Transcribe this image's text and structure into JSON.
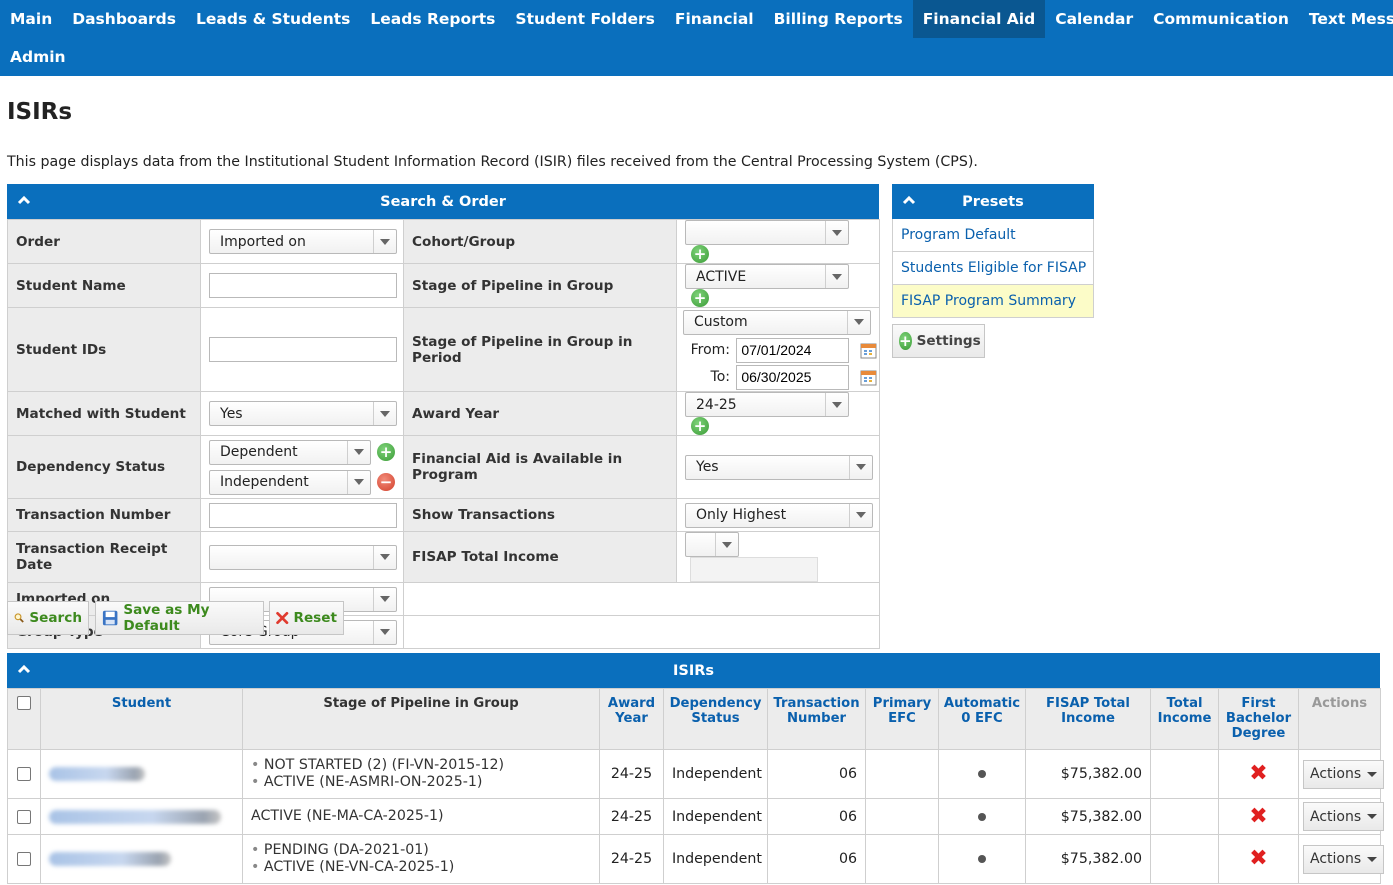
{
  "nav": {
    "items": [
      "Main",
      "Dashboards",
      "Leads & Students",
      "Leads Reports",
      "Student Folders",
      "Financial",
      "Billing Reports",
      "Financial Aid",
      "Calendar",
      "Communication",
      "Text Messages"
    ],
    "row2": [
      "Admin"
    ],
    "active": "Financial Aid"
  },
  "page": {
    "title": "ISIRs",
    "description": "This page displays data from the Institutional Student Information Record (ISIR) files received from the Central Processing System (CPS)."
  },
  "search": {
    "heading": "Search & Order",
    "order_label": "Order",
    "order_value": "Imported on",
    "student_name_label": "Student Name",
    "student_name_value": "",
    "student_ids_label": "Student IDs",
    "student_ids_value": "",
    "matched_label": "Matched with Student",
    "matched_value": "Yes",
    "dependency_label": "Dependency Status",
    "dependency_values": [
      "Dependent",
      "Independent"
    ],
    "transaction_number_label": "Transaction Number",
    "transaction_number_value": "",
    "receipt_date_label": "Transaction Receipt Date",
    "receipt_date_value": "",
    "imported_label": "Imported on",
    "imported_value": "",
    "group_type_label": "Group Type",
    "group_type_value": "Core Group",
    "cohort_label": "Cohort/Group",
    "cohort_value": "",
    "stage_label": "Stage of Pipeline in Group",
    "stage_value": "ACTIVE",
    "stage_period_label": "Stage of Pipeline in Group in Period",
    "stage_period_value": "Custom",
    "from_label": "From:",
    "from_value": "07/01/2024",
    "to_label": "To:",
    "to_value": "06/30/2025",
    "award_year_label": "Award Year",
    "award_year_value": "24-25",
    "fa_available_label": "Financial Aid is Available in Program",
    "fa_available_value": "Yes",
    "show_transactions_label": "Show Transactions",
    "show_transactions_value": "Only Highest",
    "fisap_label": "FISAP Total Income",
    "fisap_value": ""
  },
  "buttons": {
    "search": "Search",
    "save_default": "Save as My Default",
    "reset": "Reset",
    "settings": "Settings"
  },
  "presets": {
    "heading": "Presets",
    "items": [
      "Program Default",
      "Students Eligible for FISAP",
      "FISAP Program Summary"
    ]
  },
  "isirs": {
    "heading": "ISIRs",
    "columns": {
      "student": "Student",
      "stage": "Stage of Pipeline in Group",
      "award_year": "Award Year",
      "dependency": "Dependency Status",
      "transaction": "Transaction Number",
      "primary_efc": "Primary EFC",
      "auto_efc": "Automatic 0 EFC",
      "fisap": "FISAP Total Income",
      "total_income": "Total Income",
      "first_bachelor": "First Bachelor Degree",
      "actions": "Actions"
    },
    "rows": [
      {
        "stages": [
          "NOT STARTED (2) (FI-VN-2015-12)",
          "ACTIVE (NE-ASMRI-ON-2025-1)"
        ],
        "bulleted": true,
        "award_year": "24-25",
        "dependency": "Independent",
        "transaction": "06",
        "primary_efc": "",
        "fisap": "$75,382.00",
        "total_income": "",
        "actions": "Actions"
      },
      {
        "stages": [
          "ACTIVE (NE-MA-CA-2025-1)"
        ],
        "bulleted": false,
        "award_year": "24-25",
        "dependency": "Independent",
        "transaction": "06",
        "primary_efc": "",
        "fisap": "$75,382.00",
        "total_income": "",
        "actions": "Actions"
      },
      {
        "stages": [
          "PENDING (DA-2021-01)",
          "ACTIVE (NE-VN-CA-2025-1)"
        ],
        "bulleted": true,
        "award_year": "24-25",
        "dependency": "Independent",
        "transaction": "06",
        "primary_efc": "",
        "fisap": "$75,382.00",
        "total_income": "",
        "actions": "Actions"
      }
    ]
  },
  "colors": {
    "nav_bg": "#0a6fbd",
    "nav_active": "#0a5791",
    "link": "#0a60ad",
    "preset_highlight": "#fcfcc8",
    "reject": "#e02020"
  }
}
